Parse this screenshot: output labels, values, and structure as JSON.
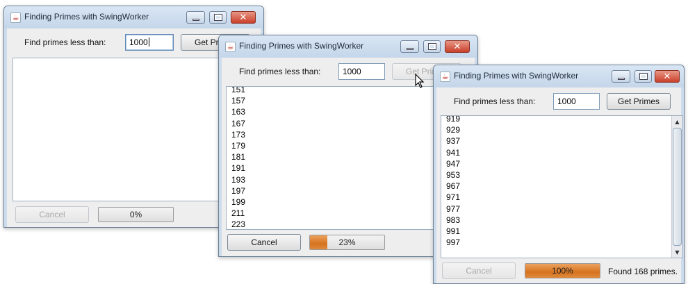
{
  "windows": [
    {
      "title": "Finding Primes with SwingWorker",
      "input_label": "Find primes less than:",
      "input_value": "1000",
      "button_label": "Get Primes",
      "cancel_label": "Cancel",
      "progress_text": "0%",
      "progress_fraction": 0.0,
      "primes": [],
      "status": ""
    },
    {
      "title": "Finding Primes with SwingWorker",
      "input_label": "Find primes less than:",
      "input_value": "1000",
      "button_label": "Get Primes",
      "cancel_label": "Cancel",
      "progress_text": "23%",
      "progress_fraction": 0.23,
      "primes": [
        "151",
        "157",
        "163",
        "167",
        "173",
        "179",
        "181",
        "191",
        "193",
        "197",
        "199",
        "211",
        "223"
      ],
      "status": ""
    },
    {
      "title": "Finding Primes with SwingWorker",
      "input_label": "Find primes less than:",
      "input_value": "1000",
      "button_label": "Get Primes",
      "cancel_label": "Cancel",
      "progress_text": "100%",
      "progress_fraction": 1.0,
      "primes": [
        "919",
        "929",
        "937",
        "941",
        "947",
        "953",
        "967",
        "971",
        "977",
        "983",
        "991",
        "997"
      ],
      "status": "Found 168 primes."
    }
  ],
  "colors": {
    "progress_fill": "#d5731f",
    "window_frame": "#ccdcec",
    "close_button": "#c9402a"
  },
  "icons": [
    "java-cup-icon",
    "minimize-icon",
    "maximize-icon",
    "close-icon",
    "mouse-pointer-icon"
  ]
}
